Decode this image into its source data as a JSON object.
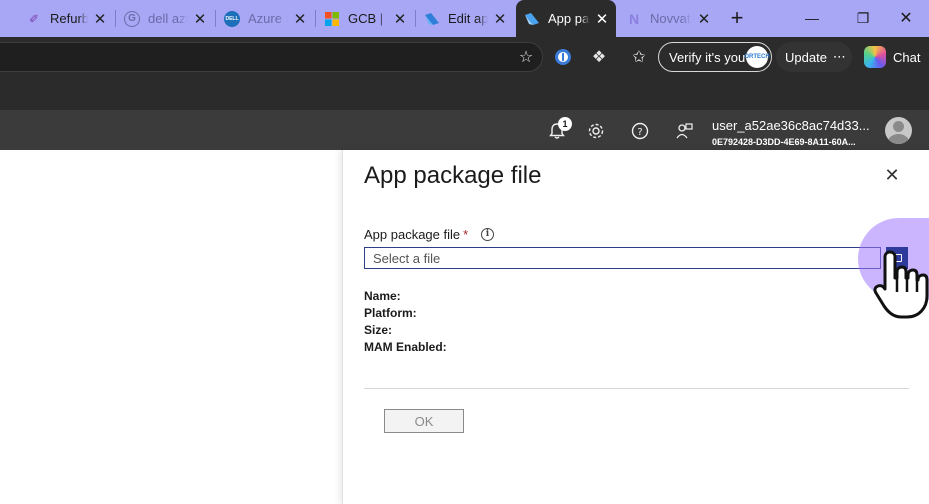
{
  "browser": {
    "tabs": [
      {
        "label": "Refurbis",
        "favicon": "refurbis-icon",
        "fav_glyph": "✐",
        "fav_color": "#7a3fb0",
        "active": false,
        "muted": false
      },
      {
        "label": "dell azur",
        "favicon": "google-icon",
        "fav_glyph": "G",
        "fav_color": "#6b6aa8",
        "active": false,
        "muted": true
      },
      {
        "label": "Azure St",
        "favicon": "dell-icon",
        "fav_glyph": "DELL",
        "fav_color": "#1c6fb8",
        "active": false,
        "muted": true
      },
      {
        "label": "GCB | Cu",
        "favicon": "microsoft-icon",
        "fav_glyph": "",
        "fav_color": "",
        "active": false,
        "muted": false
      },
      {
        "label": "Edit app",
        "favicon": "intune-icon",
        "fav_glyph": "◆",
        "fav_color": "#2f7fd8",
        "active": false,
        "muted": false
      },
      {
        "label": "App pac",
        "favicon": "intune-icon",
        "fav_glyph": "◆",
        "fav_color": "#4aa3f0",
        "active": true,
        "muted": false
      },
      {
        "label": "Novvati",
        "favicon": "novvati-icon",
        "fav_glyph": "N",
        "fav_color": "#8a7fe0",
        "active": false,
        "muted": true
      }
    ],
    "new_tab_glyph": "+",
    "toolbar": {
      "verify_label": "Verify it's you",
      "verify_badge": "ORTECH",
      "update_label": "Update",
      "update_more": "⋯",
      "chat_label": "Chat"
    }
  },
  "portal": {
    "notifications_count": "1",
    "username": "user_a52ae36c8ac74d33...",
    "tenant": "0E792428-D3DD-4E69-8A11-60A..."
  },
  "panel": {
    "title": "App package file",
    "close_glyph": "✕",
    "field_label": "App package file",
    "required_mark": "*",
    "info_glyph": "i",
    "file_placeholder": "Select a file",
    "meta": {
      "name_label": "Name:",
      "platform_label": "Platform:",
      "size_label": "Size:",
      "mam_label": "MAM Enabled:"
    },
    "ok_label": "OK"
  }
}
